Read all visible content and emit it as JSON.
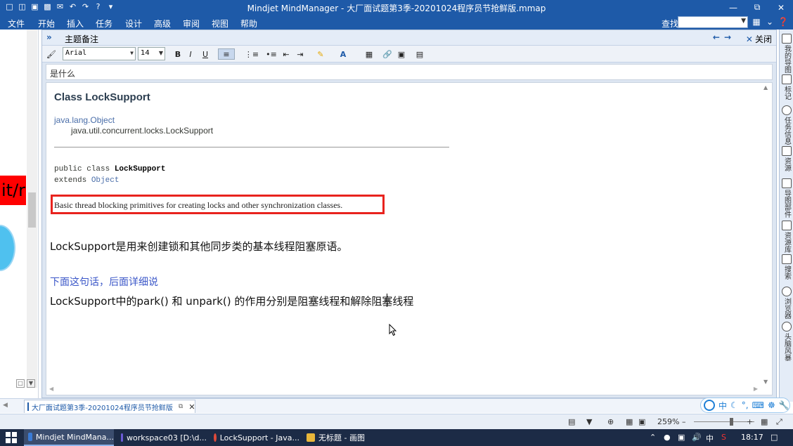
{
  "window": {
    "title": "Mindjet MindManager - 大厂面试题第3季-20201024程序员节抢鲜版.mmap"
  },
  "menu": {
    "items": [
      "文件",
      "开始",
      "插入",
      "任务",
      "设计",
      "高级",
      "审阅",
      "视图",
      "帮助"
    ],
    "find_label": "查找:"
  },
  "left_canvas": {
    "partial_text": "it/r"
  },
  "notes_panel": {
    "title": "主题备注",
    "close_label": "关闭",
    "font_name": "Arial",
    "font_size": "14",
    "subject": "是什么"
  },
  "document": {
    "class_title": "Class LockSupport",
    "package": "java.lang.Object",
    "fqcn": "java.util.concurrent.locks.LockSupport",
    "decl_keyword": "public class ",
    "decl_name": "LockSupport",
    "extends_keyword": "extends ",
    "extends_name": "Object",
    "description": "Basic thread blocking primitives for creating locks and other synchronization classes.",
    "line1": "LockSupport是用来创建锁和其他同步类的基本线程阻塞原语。",
    "line2": "下面这句话，后面详细说",
    "line3": "LockSupport中的park() 和 unpark() 的作用分别是阻塞线程和解除阻塞线程"
  },
  "right_sidebar": {
    "items": [
      "我的导图",
      "标记",
      "任务信息",
      "资源",
      "导图部件",
      "资源库",
      "搜索",
      "浏览器",
      "头脑风暴"
    ]
  },
  "doc_tab": {
    "label": "大厂面试题第3季-20201024程序员节抢鲜版"
  },
  "ime": {
    "mode": "中"
  },
  "status": {
    "zoom": "259%"
  },
  "taskbar": {
    "tasks": [
      "Mindjet MindMana...",
      "workspace03 [D:\\d...",
      "LockSupport - Java...",
      "无标题 - 画图"
    ],
    "ime_indicator": "中",
    "time": "18:17"
  },
  "colors": {
    "titlebar": "#1e5aa8",
    "highlight_box": "#e8231e",
    "link": "#4a6ea9",
    "note_blue": "#3b57c8"
  }
}
